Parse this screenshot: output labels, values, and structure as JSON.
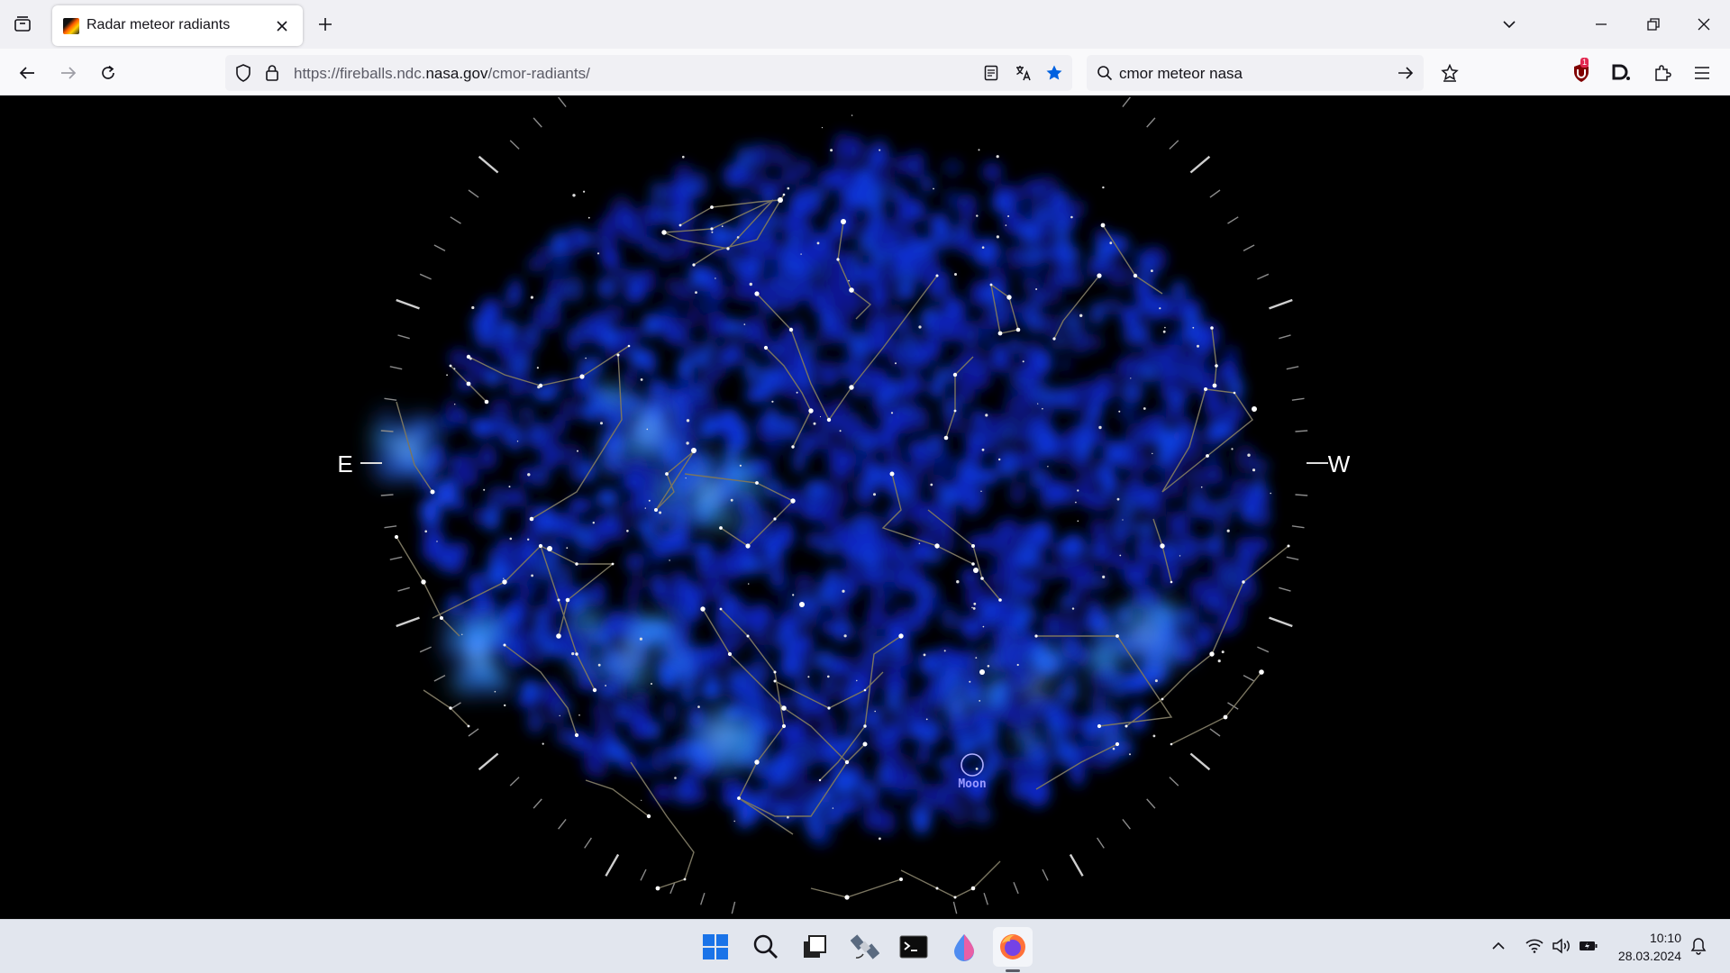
{
  "browser": {
    "tab": {
      "title": "Radar meteor radiants"
    },
    "url": {
      "prefix": "https://fireballs.ndc.",
      "domain": "nasa.gov",
      "path": "/cmor-radiants/"
    },
    "search": {
      "value": "cmor meteor nasa"
    },
    "extension_badge": "1"
  },
  "sky_map": {
    "compass": {
      "east": "E",
      "west": "W"
    },
    "moon_label": "Moon"
  },
  "taskbar": {
    "apps": [
      "start-menu",
      "search",
      "task-view",
      "satellite-app",
      "terminal",
      "paint-app",
      "firefox"
    ],
    "clock": {
      "time": "10:10",
      "date": "28.03.2024"
    }
  }
}
